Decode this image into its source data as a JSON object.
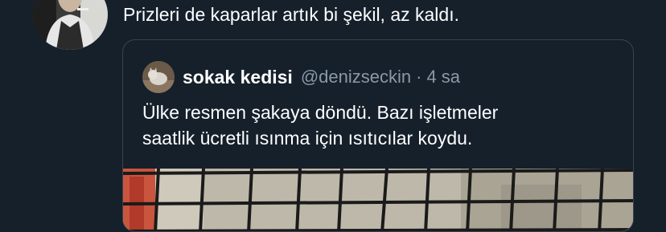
{
  "tweet": {
    "text": "Prizleri de kaparlar artık bi şekil, az kaldı."
  },
  "quote": {
    "name": "sokak kedisi",
    "handle": "@denizseckin",
    "separator": "·",
    "time": "4 sa",
    "text_line1": "Ülke resmen şakaya döndü. Bazı işletmeler",
    "text_line2": "saatlik ücretli ısınma için ısıtıcılar koydu."
  },
  "colors": {
    "background": "#15202b",
    "text": "#ffffff",
    "secondary_text": "#8b98a5",
    "border": "#38444d"
  }
}
